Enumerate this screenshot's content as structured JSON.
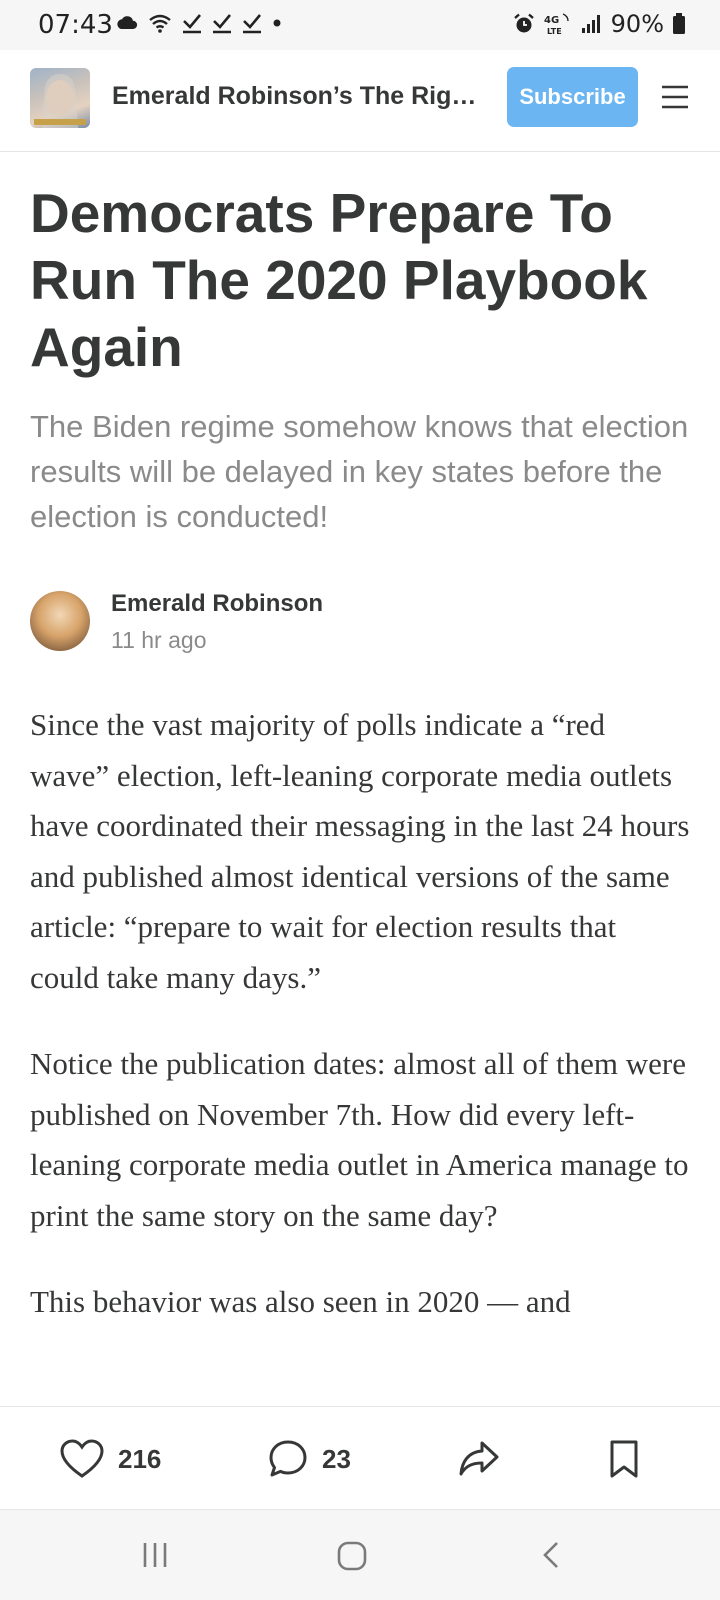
{
  "status_bar": {
    "time": "07:43",
    "battery": "90%",
    "icons_left": [
      "cloud-icon",
      "wifi-icon",
      "check-icon",
      "check-icon",
      "check-icon",
      "dot-icon"
    ],
    "icons_right": [
      "alarm-icon",
      "lte-icon",
      "signal-icon",
      "battery-icon"
    ]
  },
  "header": {
    "publication_title": "Emerald Robinson’s The Right ...",
    "subscribe_label": "Subscribe",
    "menu_icon": "hamburger-menu-icon"
  },
  "article": {
    "title": "Democrats Prepare To Run The 2020 Playbook Again",
    "subtitle": "The Biden regime somehow knows that election results will be delayed in key states before the election is conducted!",
    "author": "Emerald Robinson",
    "time_ago": "11 hr ago",
    "paragraphs": [
      "Since the vast majority of polls indicate a “red wave” election, left-leaning corporate media outlets have coordinated their messaging in the last 24 hours and published almost identical versions of the same article: “prepare to wait for election results that could take many days.”",
      "Notice the publication dates: almost all of them were published on November 7th. How did every left-leaning corporate media outlet in America manage to print the same story on the same day?",
      "This behavior was also seen in 2020 — and"
    ]
  },
  "actions": {
    "likes": "216",
    "comments": "23",
    "share_icon": "share-icon",
    "bookmark_icon": "bookmark-icon"
  },
  "nav": {
    "recents_icon": "recents-icon",
    "home_icon": "home-icon",
    "back_icon": "back-icon"
  },
  "colors": {
    "accent": "#6bb5f2",
    "text": "#363737",
    "muted": "#8a8a8a"
  }
}
